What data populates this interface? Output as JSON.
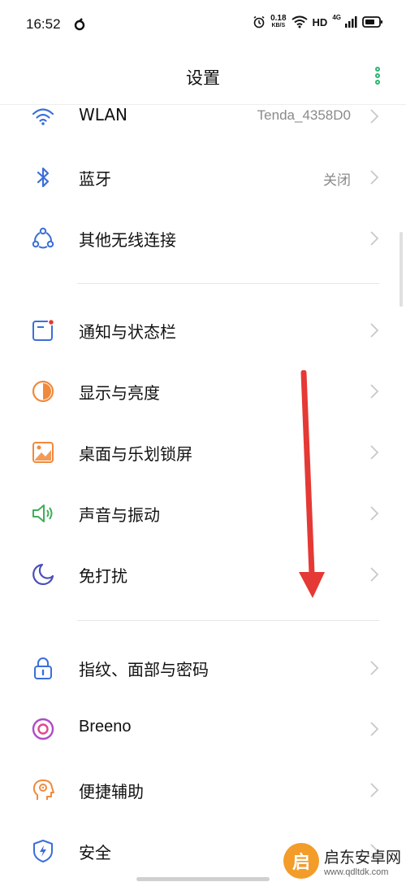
{
  "status_bar": {
    "time": "16:52",
    "net_speed_value": "0.18",
    "net_speed_unit": "KB/S",
    "hd": "HD",
    "signal_type": "4G"
  },
  "header": {
    "title": "设置"
  },
  "settings": {
    "wlan": {
      "label": "WLAN",
      "value": "Tenda_4358D0"
    },
    "bluetooth": {
      "label": "蓝牙",
      "value": "关闭"
    },
    "other_wireless": {
      "label": "其他无线连接"
    },
    "notification": {
      "label": "通知与状态栏"
    },
    "display": {
      "label": "显示与亮度"
    },
    "desktop": {
      "label": "桌面与乐划锁屏"
    },
    "sound": {
      "label": "声音与振动"
    },
    "dnd": {
      "label": "免打扰"
    },
    "fingerprint": {
      "label": "指纹、面部与密码"
    },
    "breeno": {
      "label": "Breeno"
    },
    "accessibility": {
      "label": "便捷辅助"
    },
    "security": {
      "label": "安全"
    }
  },
  "watermark": {
    "logo": "启",
    "title": "启东安卓网",
    "url": "www.qdltdk.com"
  },
  "colors": {
    "accent_green": "#2bb673",
    "arrow_red": "#e53935",
    "icon_blue": "#3b6fd8",
    "icon_orange": "#f08a3c"
  },
  "icons": [
    "wifi-icon",
    "bluetooth-icon",
    "wireless-connect-icon",
    "notification-icon",
    "display-icon",
    "wallpaper-icon",
    "speaker-icon",
    "moon-icon",
    "lock-icon",
    "breeno-icon",
    "accessibility-icon",
    "shield-icon"
  ]
}
